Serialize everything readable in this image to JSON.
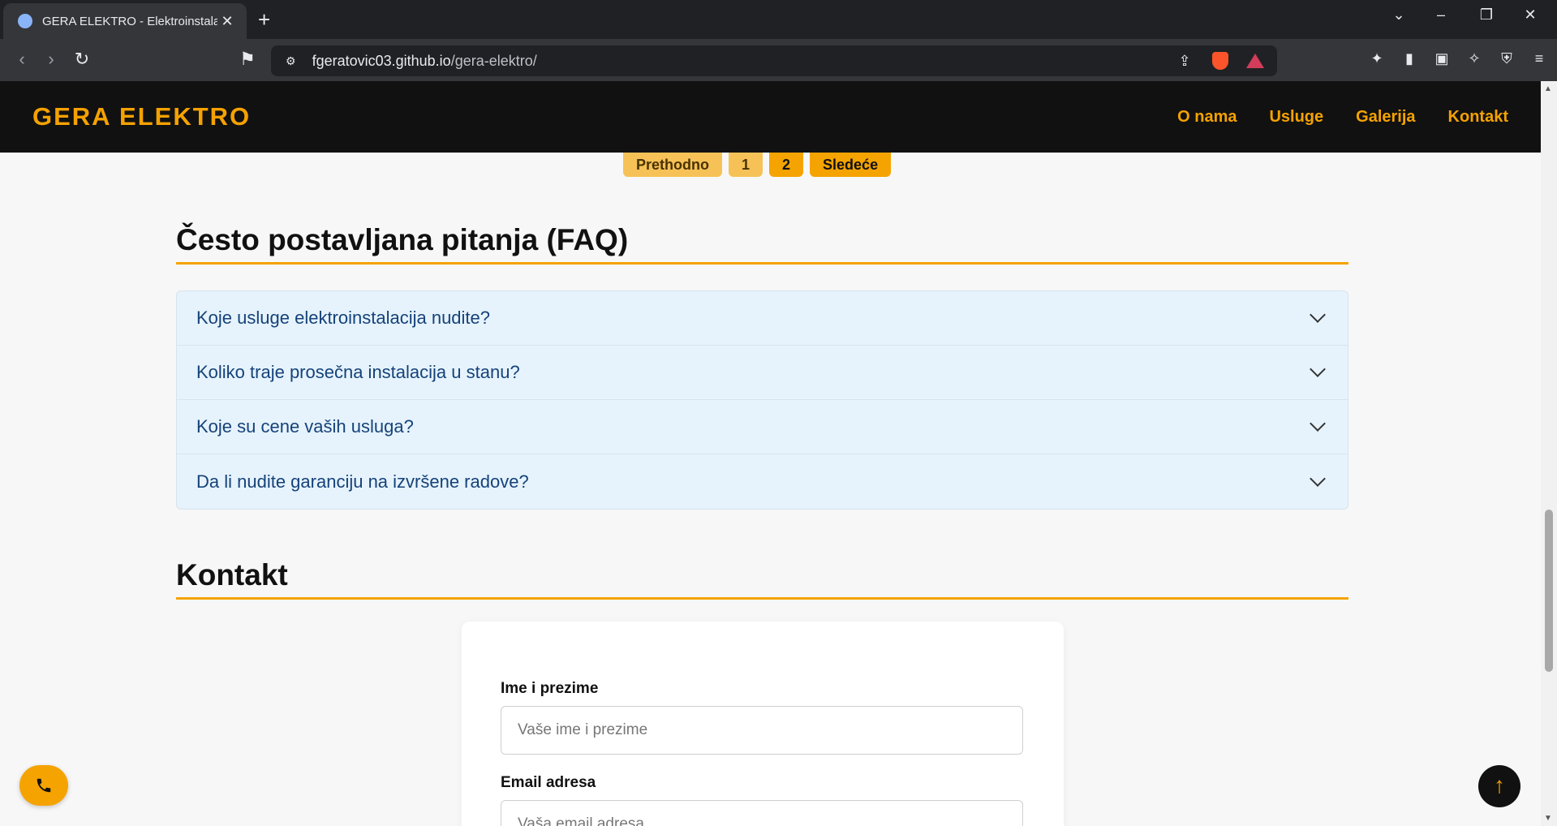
{
  "browser": {
    "tab_title": "GERA ELEKTRO - Elektroinstalacij",
    "tab_close": "✕",
    "new_tab": "+",
    "url_host": "fgeratovic03.github.io",
    "url_path": "/gera-elektro/"
  },
  "header": {
    "logo": "GERA ELEKTRO",
    "nav": [
      "O nama",
      "Usluge",
      "Galerija",
      "Kontakt"
    ]
  },
  "pagination": {
    "prev": "Prethodno",
    "pages": [
      "1",
      "2"
    ],
    "next": "Sledeće"
  },
  "faq": {
    "title": "Često postavljana pitanja (FAQ)",
    "items": [
      "Koje usluge elektroinstalacija nudite?",
      "Koliko traje prosečna instalacija u stanu?",
      "Koje su cene vaših usluga?",
      "Da li nudite garanciju na izvršene radove?"
    ]
  },
  "contact": {
    "title": "Kontakt",
    "name_label": "Ime i prezime",
    "name_placeholder": "Vaše ime i prezime",
    "email_label": "Email adresa",
    "email_placeholder": "Vaša email adresa"
  },
  "colors": {
    "accent": "#f5a300",
    "faq_text": "#15427a",
    "faq_bg": "#e6f3fc"
  }
}
